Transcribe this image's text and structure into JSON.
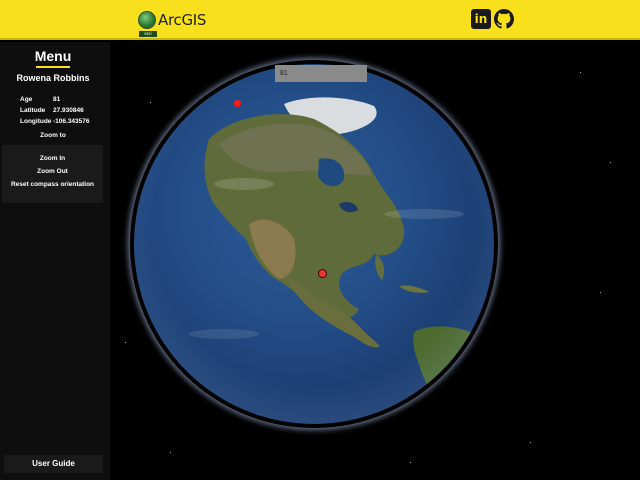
{
  "header": {
    "logo_text": "ArcGIS",
    "logo_badge": "esri",
    "linkedin_label": "in",
    "linkedin_icon": "linkedin-icon",
    "github_icon": "github-icon",
    "accent_color": "#f8e01c"
  },
  "sidebar": {
    "title": "Menu",
    "person_name": "Rowena Robbins",
    "info": [
      {
        "key": "Age",
        "value": "81"
      },
      {
        "key": "Latitude",
        "value": "27.930846"
      },
      {
        "key": "Longitude",
        "value": "-106.343576"
      }
    ],
    "zoom_to": "Zoom to",
    "nav_buttons": [
      "Zoom In",
      "Zoom Out",
      "Reset compass orientation"
    ],
    "user_guide": "User Guide"
  },
  "map": {
    "search_value": "81",
    "marker_color": "#ff1a1a"
  }
}
